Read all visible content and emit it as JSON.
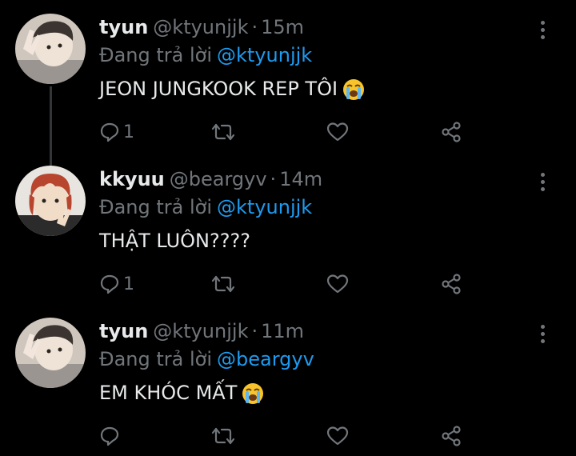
{
  "tweets": [
    {
      "name": "tyun",
      "handle": "@ktyunjjk",
      "separator": "·",
      "time": "15m",
      "reply_prefix": "Đang trả lời",
      "reply_to": "@ktyunjjk",
      "text": "JEON JUNGKOOK REP TÔI",
      "emoji": "loudly-crying-face",
      "reply_count": "1",
      "avatar": "avatar-user-tyun"
    },
    {
      "name": "kkyuu",
      "handle": "@beargyv",
      "separator": "·",
      "time": "14m",
      "reply_prefix": "Đang trả lời",
      "reply_to": "@ktyunjjk",
      "text": "THẬT LUÔN????",
      "emoji": "",
      "reply_count": "1",
      "avatar": "avatar-user-kkyuu"
    },
    {
      "name": "tyun",
      "handle": "@ktyunjjk",
      "separator": "·",
      "time": "11m",
      "reply_prefix": "Đang trả lời",
      "reply_to": "@beargyv",
      "text": "EM KHÓC MẤT",
      "emoji": "loudly-crying-face",
      "reply_count": "",
      "avatar": "avatar-user-tyun"
    }
  ],
  "colors": {
    "background": "#000000",
    "primary_text": "#e7e9ea",
    "secondary_text": "#71767b",
    "link": "#1d9bf0",
    "thread_line": "#333639"
  }
}
